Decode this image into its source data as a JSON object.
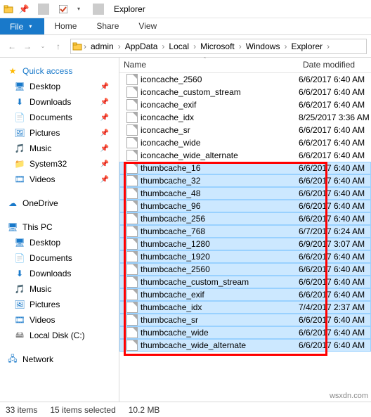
{
  "window": {
    "title": "Explorer"
  },
  "ribbon": {
    "file": "File",
    "home": "Home",
    "share": "Share",
    "view": "View"
  },
  "breadcrumb": [
    "admin",
    "AppData",
    "Local",
    "Microsoft",
    "Windows",
    "Explorer"
  ],
  "nav": {
    "quick_access": "Quick access",
    "pinned": [
      {
        "label": "Desktop"
      },
      {
        "label": "Downloads"
      },
      {
        "label": "Documents"
      },
      {
        "label": "Pictures"
      },
      {
        "label": "Music"
      },
      {
        "label": "System32"
      },
      {
        "label": "Videos"
      }
    ],
    "onedrive": "OneDrive",
    "this_pc": "This PC",
    "pc_items": [
      {
        "label": "Desktop"
      },
      {
        "label": "Documents"
      },
      {
        "label": "Downloads"
      },
      {
        "label": "Music"
      },
      {
        "label": "Pictures"
      },
      {
        "label": "Videos"
      },
      {
        "label": "Local Disk (C:)"
      }
    ],
    "network": "Network"
  },
  "columns": {
    "name": "Name",
    "date": "Date modified"
  },
  "files_unselected": [
    {
      "name": "iconcache_2560",
      "date": "6/6/2017 6:40 AM"
    },
    {
      "name": "iconcache_custom_stream",
      "date": "6/6/2017 6:40 AM"
    },
    {
      "name": "iconcache_exif",
      "date": "6/6/2017 6:40 AM"
    },
    {
      "name": "iconcache_idx",
      "date": "8/25/2017 3:36 AM"
    },
    {
      "name": "iconcache_sr",
      "date": "6/6/2017 6:40 AM"
    },
    {
      "name": "iconcache_wide",
      "date": "6/6/2017 6:40 AM"
    },
    {
      "name": "iconcache_wide_alternate",
      "date": "6/6/2017 6:40 AM"
    }
  ],
  "files_selected": [
    {
      "name": "thumbcache_16",
      "date": "6/6/2017 6:40 AM"
    },
    {
      "name": "thumbcache_32",
      "date": "6/6/2017 6:40 AM"
    },
    {
      "name": "thumbcache_48",
      "date": "6/6/2017 6:40 AM"
    },
    {
      "name": "thumbcache_96",
      "date": "6/6/2017 6:40 AM"
    },
    {
      "name": "thumbcache_256",
      "date": "6/6/2017 6:40 AM"
    },
    {
      "name": "thumbcache_768",
      "date": "6/7/2017 6:24 AM"
    },
    {
      "name": "thumbcache_1280",
      "date": "6/9/2017 3:07 AM"
    },
    {
      "name": "thumbcache_1920",
      "date": "6/6/2017 6:40 AM"
    },
    {
      "name": "thumbcache_2560",
      "date": "6/6/2017 6:40 AM"
    },
    {
      "name": "thumbcache_custom_stream",
      "date": "6/6/2017 6:40 AM"
    },
    {
      "name": "thumbcache_exif",
      "date": "6/6/2017 6:40 AM"
    },
    {
      "name": "thumbcache_idx",
      "date": "7/4/2017 2:37 AM"
    },
    {
      "name": "thumbcache_sr",
      "date": "6/6/2017 6:40 AM"
    },
    {
      "name": "thumbcache_wide",
      "date": "6/6/2017 6:40 AM"
    },
    {
      "name": "thumbcache_wide_alternate",
      "date": "6/6/2017 6:40 AM"
    }
  ],
  "status": {
    "items": "33 items",
    "selected": "15 items selected",
    "size": "10.2 MB"
  },
  "watermark": "wsxdn.com"
}
